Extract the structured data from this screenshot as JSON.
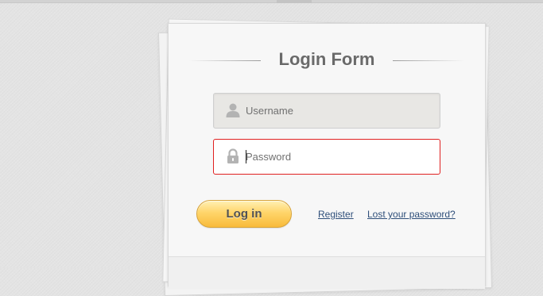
{
  "form": {
    "title": "Login Form",
    "username_placeholder": "Username",
    "password_placeholder": "Password",
    "login_label": "Log in",
    "register_label": "Register",
    "lost_password_label": "Lost your password?",
    "username_icon": "user-icon",
    "password_icon": "lock-icon"
  },
  "colors": {
    "button_gradient_top": "#fff0b5",
    "button_gradient_bottom": "#f8bb3b",
    "focused_field_border": "#e02020",
    "link": "#2f4f7a",
    "title": "#6a6a6a"
  }
}
